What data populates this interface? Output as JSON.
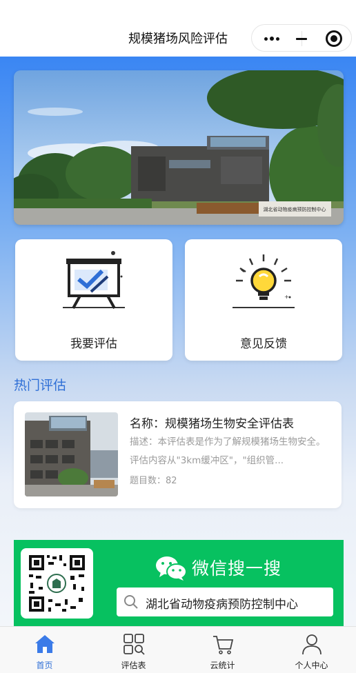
{
  "navbar": {
    "title": "规模猪场风险评估",
    "more_icon": "more-dots-icon",
    "minimize_icon": "minimize-icon",
    "close_icon": "target-close-icon"
  },
  "banner": {
    "image_label": "湖北省动物疫病预防控制中心"
  },
  "actions": [
    {
      "label": "我要评估",
      "icon": "whiteboard-check-icon"
    },
    {
      "label": "意见反馈",
      "icon": "lightbulb-icon"
    }
  ],
  "hot": {
    "section_title": "热门评估",
    "items": [
      {
        "name": "名称：规模猪场生物安全评估表",
        "description": "描述：本评估表是作为了解规模猪场生物安全。评估内容从\"3km缓冲区\"，\"组织管...",
        "question_count": "题目数：82"
      }
    ]
  },
  "promo": {
    "wechat_text": "微信搜一搜",
    "search_text": "湖北省动物疫病预防控制中心",
    "accent_color": "#07c160"
  },
  "tabbar": {
    "active_color": "#2f6fd6",
    "tabs": [
      {
        "label": "首页",
        "icon": "home-icon"
      },
      {
        "label": "评估表",
        "icon": "grid-search-icon"
      },
      {
        "label": "云统计",
        "icon": "cart-icon"
      },
      {
        "label": "个人中心",
        "icon": "user-icon"
      }
    ]
  }
}
